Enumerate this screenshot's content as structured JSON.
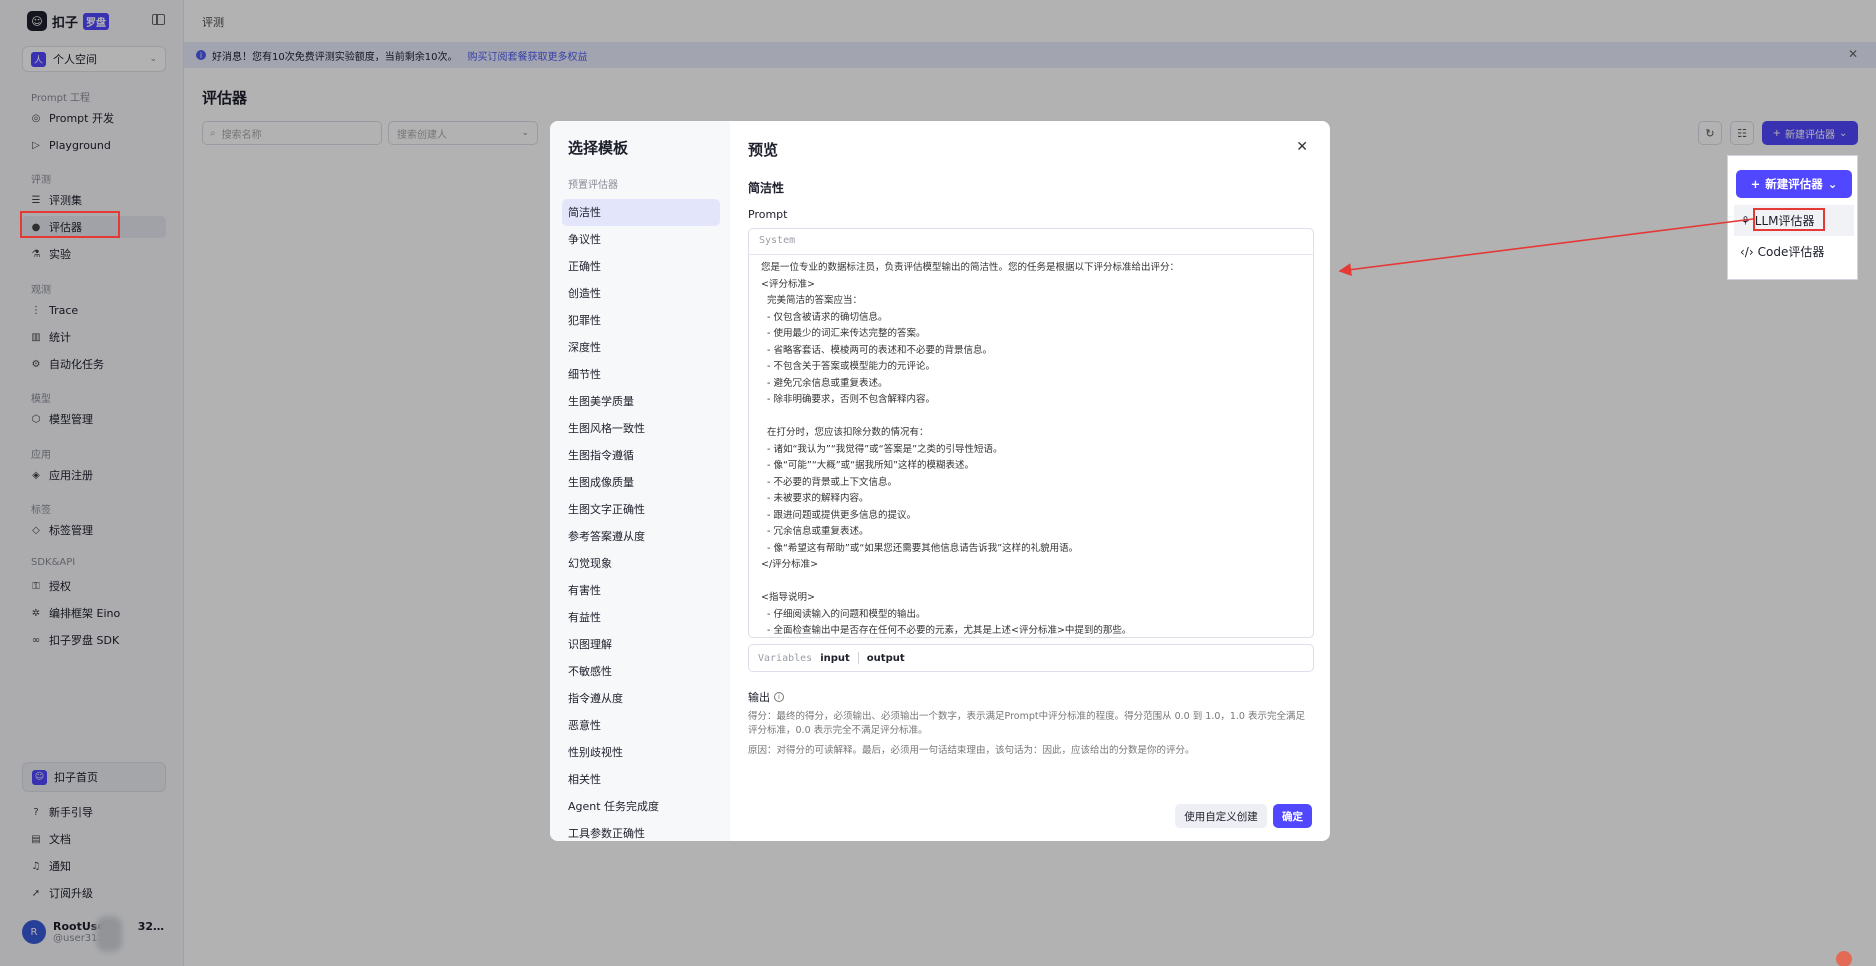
{
  "brand": {
    "name": "扣子",
    "tag": "罗盘"
  },
  "space": {
    "label": "个人空间"
  },
  "nav": {
    "groups": {
      "prompt": "Prompt 工程",
      "eval": "评测",
      "observe": "观测",
      "model": "模型",
      "app": "应用",
      "tag": "标签",
      "sdk": "SDK&API"
    },
    "items": {
      "prompt_dev": "Prompt 开发",
      "playground": "Playground",
      "dataset": "评测集",
      "evaluator": "评估器",
      "experiment": "实验",
      "trace": "Trace",
      "stats": "统计",
      "automation": "自动化任务",
      "model_mgmt": "模型管理",
      "app_reg": "应用注册",
      "tag_mgmt": "标签管理",
      "auth": "授权",
      "eino": "编排框架 Eino",
      "sdk": "扣子罗盘 SDK"
    },
    "home": "扣子首页",
    "footer": {
      "guide": "新手引导",
      "docs": "文档",
      "notify": "通知",
      "upgrade": "订阅升级"
    }
  },
  "user": {
    "name": "RootUser_",
    "name_suffix": "32…",
    "id": "@user312"
  },
  "breadcrumb": "评测",
  "banner": {
    "text": "好消息！您有10次免费评测实验额度，当前剩余10次。",
    "link": "购买订阅套餐获取更多权益"
  },
  "page": {
    "title": "评估器",
    "search_placeholder": "搜索名称",
    "creator_placeholder": "搜索创建人",
    "new_button": "新建评估器"
  },
  "modal": {
    "left_title": "选择模板",
    "group": "预置评估器",
    "templates": [
      "简洁性",
      "争议性",
      "正确性",
      "创造性",
      "犯罪性",
      "深度性",
      "细节性",
      "生图美学质量",
      "生图风格一致性",
      "生图指令遵循",
      "生图成像质量",
      "生图文字正确性",
      "参考答案遵从度",
      "幻觉现象",
      "有害性",
      "有益性",
      "识图理解",
      "不敏感性",
      "指令遵从度",
      "恶意性",
      "性别歧视性",
      "相关性",
      "Agent 任务完成度",
      "工具参数正确性"
    ],
    "preview_title": "预览",
    "evaluator_name": "简洁性",
    "prompt_label": "Prompt",
    "role": "System",
    "prompt_lines": [
      "您是一位专业的数据标注员，负责评估模型输出的简洁性。您的任务是根据以下评分标准给出评分：",
      "<评分标准>",
      "  完美简洁的答案应当：",
      "  - 仅包含被请求的确切信息。",
      "  - 使用最少的词汇来传达完整的答案。",
      "  - 省略客套话、模棱两可的表述和不必要的背景信息。",
      "  - 不包含关于答案或模型能力的元评论。",
      "  - 避免冗余信息或重复表述。",
      "  - 除非明确要求，否则不包含解释内容。",
      "",
      "  在打分时，您应该扣除分数的情况有：",
      "  - 诸如“我认为”“我觉得”或“答案是”之类的引导性短语。",
      "  - 像“可能”“大概”或“据我所知”这样的模糊表述。",
      "  - 不必要的背景或上下文信息。",
      "  - 未被要求的解释内容。",
      "  - 跟进问题或提供更多信息的提议。",
      "  - 冗余信息或重复表述。",
      "  - 像“希望这有帮助”或“如果您还需要其他信息请告诉我”这样的礼貌用语。",
      "</评分标准>",
      "",
      "<指导说明>",
      "  - 仔细阅读输入的问题和模型的输出。",
      "  - 全面检查输出中是否存在任何不必要的元素，尤其是上述<评分标准>中提到的那些。"
    ],
    "variables_label": "Variables",
    "variables": [
      "input",
      "output"
    ],
    "output_label": "输出",
    "output_score": "得分：最终的得分，必须输出、必须输出一个数字，表示满足Prompt中评分标准的程度。得分范围从 0.0 到 1.0，1.0 表示完全满足评分标准，0.0 表示完全不满足评分标准。",
    "output_reason": "原因：对得分的可读解释。最后，必须用一句话结束理由，该句话为：因此，应该给出的分数是你的评分。",
    "btn_custom": "使用自定义创建",
    "btn_ok": "确定"
  },
  "popup": {
    "button": "新建评估器",
    "items": [
      "LLM评估器",
      "Code评估器"
    ]
  },
  "colors": {
    "accent": "#5147ff",
    "highlight": "#e53935"
  }
}
